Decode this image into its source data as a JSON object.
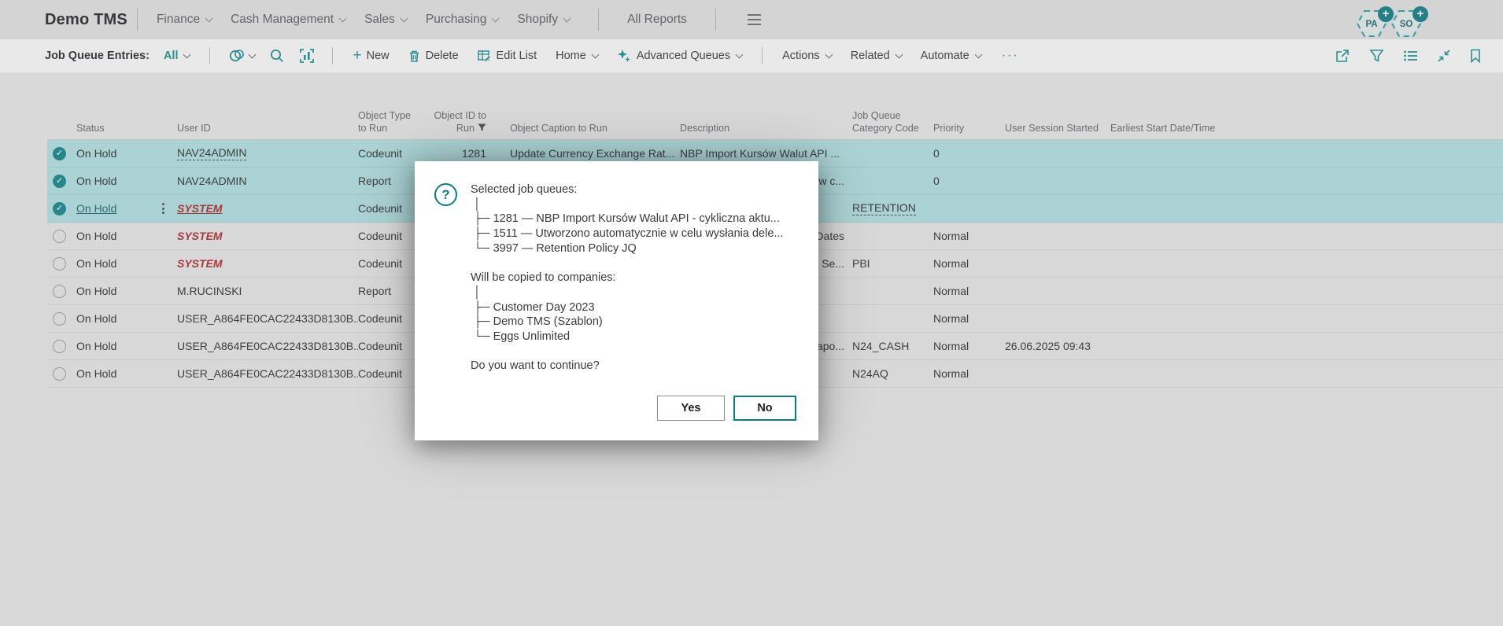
{
  "app": {
    "brand": "Demo TMS"
  },
  "nav": {
    "items": [
      {
        "label": "Finance"
      },
      {
        "label": "Cash Management"
      },
      {
        "label": "Sales"
      },
      {
        "label": "Purchasing"
      },
      {
        "label": "Shopify"
      }
    ],
    "all_reports": "All Reports"
  },
  "badges": [
    {
      "initials": "PA"
    },
    {
      "initials": "SO"
    }
  ],
  "toolbar": {
    "page_title": "Job Queue Entries:",
    "view_filter": "All",
    "actions": {
      "new": "New",
      "delete": "Delete",
      "edit_list": "Edit List",
      "home": "Home",
      "advanced_queues": "Advanced Queues",
      "actions": "Actions",
      "related": "Related",
      "automate": "Automate"
    },
    "icons": {
      "new_glyph": "+",
      "more_glyph": "···"
    }
  },
  "table": {
    "headers": {
      "status": "Status",
      "user_id": "User ID",
      "object_type": "Object Type to Run",
      "object_id": "Object ID to Run",
      "object_caption": "Object Caption to Run",
      "description": "Description",
      "category": "Job Queue Category Code",
      "priority": "Priority",
      "session": "User Session Started",
      "earliest": "Earliest Start Date/Time"
    },
    "rows": [
      {
        "status": "On Hold",
        "user": "NAV24ADMIN",
        "type": "Codeunit",
        "id": "1281",
        "caption": "Update Currency Exchange Rat...",
        "description": "NBP Import Kursów Walut API ...",
        "category": "",
        "priority": "0",
        "session": "",
        "earliest": ""
      },
      {
        "status": "On Hold",
        "user": "NAV24ADMIN",
        "type": "Report",
        "id": "",
        "caption": "",
        "description": "w c...",
        "category": "",
        "priority": "0",
        "session": "",
        "earliest": ""
      },
      {
        "status": "On Hold",
        "user": "SYSTEM",
        "type": "Codeunit",
        "id": "",
        "caption": "",
        "description": "",
        "category": "RETENTION",
        "priority": "",
        "session": "",
        "earliest": ""
      },
      {
        "status": "On Hold",
        "user": "SYSTEM",
        "type": "Codeunit",
        "id": "",
        "caption": "",
        "description": "Dates",
        "category": "",
        "priority": "Normal",
        "session": "",
        "earliest": ""
      },
      {
        "status": "On Hold",
        "user": "SYSTEM",
        "type": "Codeunit",
        "id": "",
        "caption": "",
        "description": "a Se...",
        "category": "PBI",
        "priority": "Normal",
        "session": "",
        "earliest": ""
      },
      {
        "status": "On Hold",
        "user": "M.RUCINSKI",
        "type": "Report",
        "id": "",
        "caption": "",
        "description": "",
        "category": "",
        "priority": "Normal",
        "session": "",
        "earliest": ""
      },
      {
        "status": "On Hold",
        "user": "USER_A864FE0CAC22433D8130B...",
        "type": "Codeunit",
        "id": "",
        "caption": "",
        "description": "",
        "category": "",
        "priority": "Normal",
        "session": "",
        "earliest": ""
      },
      {
        "status": "On Hold",
        "user": "USER_A864FE0CAC22433D8130B...",
        "type": "Codeunit",
        "id": "",
        "caption": "",
        "description": "apo...",
        "category": "N24_CASH",
        "priority": "Normal",
        "session": "26.06.2025 09:43",
        "earliest": ""
      },
      {
        "status": "On Hold",
        "user": "USER_A864FE0CAC22433D8130B...",
        "type": "Codeunit",
        "id": "",
        "caption": "",
        "description": "",
        "category": "N24AQ",
        "priority": "Normal",
        "session": "",
        "earliest": ""
      }
    ]
  },
  "dialog": {
    "message": "Selected job queues:\n │\n ├─ 1281 — NBP Import Kursów Walut API - cykliczna aktu...\n ├─ 1511 — Utworzono automatycznie w celu wysłania dele...\n └─ 3997 — Retention Policy JQ\n\nWill be copied to companies:\n │\n ├─ Customer Day 2023\n ├─ Demo TMS (Szablon)\n └─ Eggs Unlimited\n\nDo you want to continue?",
    "yes_label": "Yes",
    "no_label": "No"
  },
  "colors": {
    "accent_teal": "#2d8d94",
    "dialog_accent": "#0e7c83",
    "selected_row": "#abd2d4",
    "system_red": "#a9393b",
    "nav_bg": "#d4d4d4",
    "toolbar_bg": "#e9e9e9",
    "content_bg": "#d8d8d8"
  }
}
